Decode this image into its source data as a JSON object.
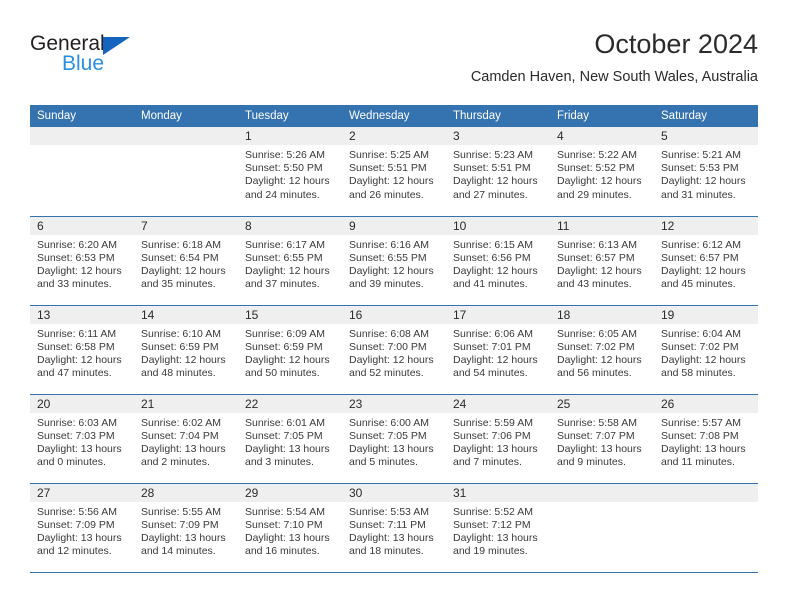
{
  "brand": {
    "name_top": "General",
    "name_bottom": "Blue",
    "color_dark": "#231f20",
    "color_blue": "#2a8fe0",
    "triangle_color": "#1565c0"
  },
  "header": {
    "title": "October 2024",
    "subtitle": "Camden Haven, New South Wales, Australia"
  },
  "theme": {
    "header_bg": "#3572b0",
    "header_text": "#ffffff",
    "daynum_bg": "#efefef",
    "grid_line": "#3572b0",
    "body_text": "#3a3a3a"
  },
  "calendar": {
    "weekday_headers": [
      "Sunday",
      "Monday",
      "Tuesday",
      "Wednesday",
      "Thursday",
      "Friday",
      "Saturday"
    ],
    "weeks": [
      [
        {
          "day": "",
          "empty": true,
          "sunrise": "",
          "sunset": "",
          "daylight_line1": "",
          "daylight_line2": ""
        },
        {
          "day": "",
          "empty": true,
          "sunrise": "",
          "sunset": "",
          "daylight_line1": "",
          "daylight_line2": ""
        },
        {
          "day": "1",
          "empty": false,
          "sunrise": "Sunrise: 5:26 AM",
          "sunset": "Sunset: 5:50 PM",
          "daylight_line1": "Daylight: 12 hours",
          "daylight_line2": "and 24 minutes."
        },
        {
          "day": "2",
          "empty": false,
          "sunrise": "Sunrise: 5:25 AM",
          "sunset": "Sunset: 5:51 PM",
          "daylight_line1": "Daylight: 12 hours",
          "daylight_line2": "and 26 minutes."
        },
        {
          "day": "3",
          "empty": false,
          "sunrise": "Sunrise: 5:23 AM",
          "sunset": "Sunset: 5:51 PM",
          "daylight_line1": "Daylight: 12 hours",
          "daylight_line2": "and 27 minutes."
        },
        {
          "day": "4",
          "empty": false,
          "sunrise": "Sunrise: 5:22 AM",
          "sunset": "Sunset: 5:52 PM",
          "daylight_line1": "Daylight: 12 hours",
          "daylight_line2": "and 29 minutes."
        },
        {
          "day": "5",
          "empty": false,
          "sunrise": "Sunrise: 5:21 AM",
          "sunset": "Sunset: 5:53 PM",
          "daylight_line1": "Daylight: 12 hours",
          "daylight_line2": "and 31 minutes."
        }
      ],
      [
        {
          "day": "6",
          "empty": false,
          "sunrise": "Sunrise: 6:20 AM",
          "sunset": "Sunset: 6:53 PM",
          "daylight_line1": "Daylight: 12 hours",
          "daylight_line2": "and 33 minutes."
        },
        {
          "day": "7",
          "empty": false,
          "sunrise": "Sunrise: 6:18 AM",
          "sunset": "Sunset: 6:54 PM",
          "daylight_line1": "Daylight: 12 hours",
          "daylight_line2": "and 35 minutes."
        },
        {
          "day": "8",
          "empty": false,
          "sunrise": "Sunrise: 6:17 AM",
          "sunset": "Sunset: 6:55 PM",
          "daylight_line1": "Daylight: 12 hours",
          "daylight_line2": "and 37 minutes."
        },
        {
          "day": "9",
          "empty": false,
          "sunrise": "Sunrise: 6:16 AM",
          "sunset": "Sunset: 6:55 PM",
          "daylight_line1": "Daylight: 12 hours",
          "daylight_line2": "and 39 minutes."
        },
        {
          "day": "10",
          "empty": false,
          "sunrise": "Sunrise: 6:15 AM",
          "sunset": "Sunset: 6:56 PM",
          "daylight_line1": "Daylight: 12 hours",
          "daylight_line2": "and 41 minutes."
        },
        {
          "day": "11",
          "empty": false,
          "sunrise": "Sunrise: 6:13 AM",
          "sunset": "Sunset: 6:57 PM",
          "daylight_line1": "Daylight: 12 hours",
          "daylight_line2": "and 43 minutes."
        },
        {
          "day": "12",
          "empty": false,
          "sunrise": "Sunrise: 6:12 AM",
          "sunset": "Sunset: 6:57 PM",
          "daylight_line1": "Daylight: 12 hours",
          "daylight_line2": "and 45 minutes."
        }
      ],
      [
        {
          "day": "13",
          "empty": false,
          "sunrise": "Sunrise: 6:11 AM",
          "sunset": "Sunset: 6:58 PM",
          "daylight_line1": "Daylight: 12 hours",
          "daylight_line2": "and 47 minutes."
        },
        {
          "day": "14",
          "empty": false,
          "sunrise": "Sunrise: 6:10 AM",
          "sunset": "Sunset: 6:59 PM",
          "daylight_line1": "Daylight: 12 hours",
          "daylight_line2": "and 48 minutes."
        },
        {
          "day": "15",
          "empty": false,
          "sunrise": "Sunrise: 6:09 AM",
          "sunset": "Sunset: 6:59 PM",
          "daylight_line1": "Daylight: 12 hours",
          "daylight_line2": "and 50 minutes."
        },
        {
          "day": "16",
          "empty": false,
          "sunrise": "Sunrise: 6:08 AM",
          "sunset": "Sunset: 7:00 PM",
          "daylight_line1": "Daylight: 12 hours",
          "daylight_line2": "and 52 minutes."
        },
        {
          "day": "17",
          "empty": false,
          "sunrise": "Sunrise: 6:06 AM",
          "sunset": "Sunset: 7:01 PM",
          "daylight_line1": "Daylight: 12 hours",
          "daylight_line2": "and 54 minutes."
        },
        {
          "day": "18",
          "empty": false,
          "sunrise": "Sunrise: 6:05 AM",
          "sunset": "Sunset: 7:02 PM",
          "daylight_line1": "Daylight: 12 hours",
          "daylight_line2": "and 56 minutes."
        },
        {
          "day": "19",
          "empty": false,
          "sunrise": "Sunrise: 6:04 AM",
          "sunset": "Sunset: 7:02 PM",
          "daylight_line1": "Daylight: 12 hours",
          "daylight_line2": "and 58 minutes."
        }
      ],
      [
        {
          "day": "20",
          "empty": false,
          "sunrise": "Sunrise: 6:03 AM",
          "sunset": "Sunset: 7:03 PM",
          "daylight_line1": "Daylight: 13 hours",
          "daylight_line2": "and 0 minutes."
        },
        {
          "day": "21",
          "empty": false,
          "sunrise": "Sunrise: 6:02 AM",
          "sunset": "Sunset: 7:04 PM",
          "daylight_line1": "Daylight: 13 hours",
          "daylight_line2": "and 2 minutes."
        },
        {
          "day": "22",
          "empty": false,
          "sunrise": "Sunrise: 6:01 AM",
          "sunset": "Sunset: 7:05 PM",
          "daylight_line1": "Daylight: 13 hours",
          "daylight_line2": "and 3 minutes."
        },
        {
          "day": "23",
          "empty": false,
          "sunrise": "Sunrise: 6:00 AM",
          "sunset": "Sunset: 7:05 PM",
          "daylight_line1": "Daylight: 13 hours",
          "daylight_line2": "and 5 minutes."
        },
        {
          "day": "24",
          "empty": false,
          "sunrise": "Sunrise: 5:59 AM",
          "sunset": "Sunset: 7:06 PM",
          "daylight_line1": "Daylight: 13 hours",
          "daylight_line2": "and 7 minutes."
        },
        {
          "day": "25",
          "empty": false,
          "sunrise": "Sunrise: 5:58 AM",
          "sunset": "Sunset: 7:07 PM",
          "daylight_line1": "Daylight: 13 hours",
          "daylight_line2": "and 9 minutes."
        },
        {
          "day": "26",
          "empty": false,
          "sunrise": "Sunrise: 5:57 AM",
          "sunset": "Sunset: 7:08 PM",
          "daylight_line1": "Daylight: 13 hours",
          "daylight_line2": "and 11 minutes."
        }
      ],
      [
        {
          "day": "27",
          "empty": false,
          "sunrise": "Sunrise: 5:56 AM",
          "sunset": "Sunset: 7:09 PM",
          "daylight_line1": "Daylight: 13 hours",
          "daylight_line2": "and 12 minutes."
        },
        {
          "day": "28",
          "empty": false,
          "sunrise": "Sunrise: 5:55 AM",
          "sunset": "Sunset: 7:09 PM",
          "daylight_line1": "Daylight: 13 hours",
          "daylight_line2": "and 14 minutes."
        },
        {
          "day": "29",
          "empty": false,
          "sunrise": "Sunrise: 5:54 AM",
          "sunset": "Sunset: 7:10 PM",
          "daylight_line1": "Daylight: 13 hours",
          "daylight_line2": "and 16 minutes."
        },
        {
          "day": "30",
          "empty": false,
          "sunrise": "Sunrise: 5:53 AM",
          "sunset": "Sunset: 7:11 PM",
          "daylight_line1": "Daylight: 13 hours",
          "daylight_line2": "and 18 minutes."
        },
        {
          "day": "31",
          "empty": false,
          "sunrise": "Sunrise: 5:52 AM",
          "sunset": "Sunset: 7:12 PM",
          "daylight_line1": "Daylight: 13 hours",
          "daylight_line2": "and 19 minutes."
        },
        {
          "day": "",
          "empty": true,
          "sunrise": "",
          "sunset": "",
          "daylight_line1": "",
          "daylight_line2": ""
        },
        {
          "day": "",
          "empty": true,
          "sunrise": "",
          "sunset": "",
          "daylight_line1": "",
          "daylight_line2": ""
        }
      ]
    ]
  }
}
